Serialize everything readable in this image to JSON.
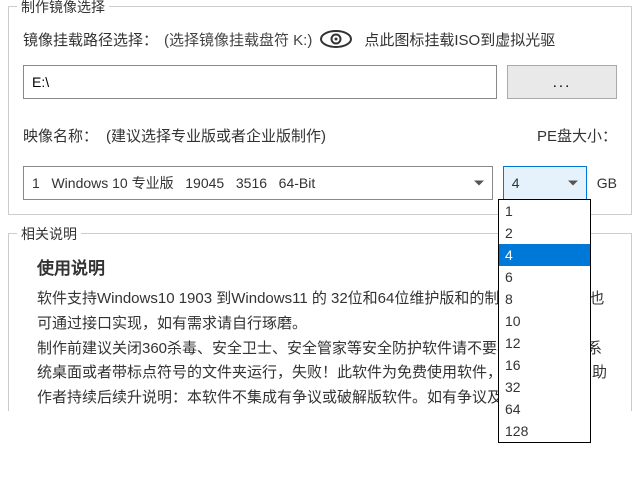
{
  "mirror_panel": {
    "title": "制作镜像选择",
    "mount_path_label": "镜像挂载路径选择：",
    "mount_path_hint": "(选择镜像挂载盘符 K:)",
    "mount_iso_hint": "点此图标挂载ISO到虚拟光驱",
    "path_value": "E:\\",
    "browse_label": "...",
    "image_name_label": "映像名称：",
    "image_name_hint": "(建议选择专业版或者企业版制作)",
    "pe_size_label": "PE盘大小：",
    "image_combo_value": "1   Windows 10 专业版   19045   3516   64-Bit",
    "size_combo_value": "4",
    "gb_unit": "GB",
    "size_options": [
      "1",
      "2",
      "4",
      "6",
      "8",
      "10",
      "12",
      "16",
      "32",
      "64",
      "128"
    ],
    "size_selected_index": 2
  },
  "info_panel": {
    "title": "相关说明",
    "usage_heading": "使用说明",
    "usage_text": "软件支持Windows10 1903 到Windows11 的 32位和64位维护版和的制作！其他版本也可通过接口实现，如有需求请自行琢磨。\n制作前建议关闭360杀毒、安全卫士、安全管家等安全防护软件请不要将软件放置到系统桌面或者带标点符号的文件夹运行，失败！此软件为免费使用软件，如果好用可捐助作者持续后续升说明：本软件不集成有争议或破解版软件。如有争议及时告知删"
  }
}
